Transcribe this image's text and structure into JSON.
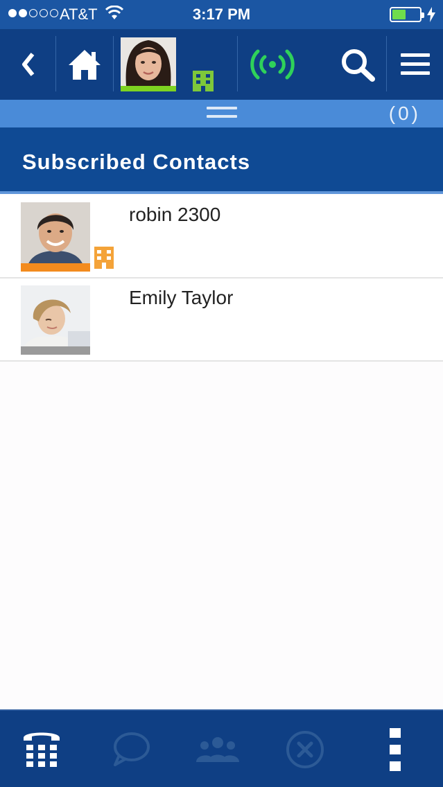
{
  "status": {
    "carrier": "AT&T",
    "time": "3:17 PM",
    "signal_bars_filled": 2,
    "signal_bars_total": 5,
    "battery_level": 0.5
  },
  "toolbar": {
    "icons": [
      "back-chevron-icon",
      "home-icon",
      "my-avatar",
      "office-building-icon",
      "broadcast-signal-icon",
      "search-icon",
      "menu-icon"
    ]
  },
  "handle": {
    "count": "(0)"
  },
  "section": {
    "title": "Subscribed Contacts"
  },
  "contacts": [
    {
      "name": "robin 2300",
      "status_color": "#f38b1e",
      "location": "office"
    },
    {
      "name": "Emily Taylor",
      "status_color": "#9a9a9a",
      "location": ""
    }
  ],
  "colors": {
    "header_blue": "#0f3f84",
    "accent_green": "#7ed321",
    "office_orange": "#f4a339"
  },
  "bottom_bar": {
    "icons": [
      "dialpad-phone-icon",
      "chat-bubble-icon",
      "contacts-group-icon",
      "close-circle-icon",
      "more-vertical-icon"
    ]
  }
}
